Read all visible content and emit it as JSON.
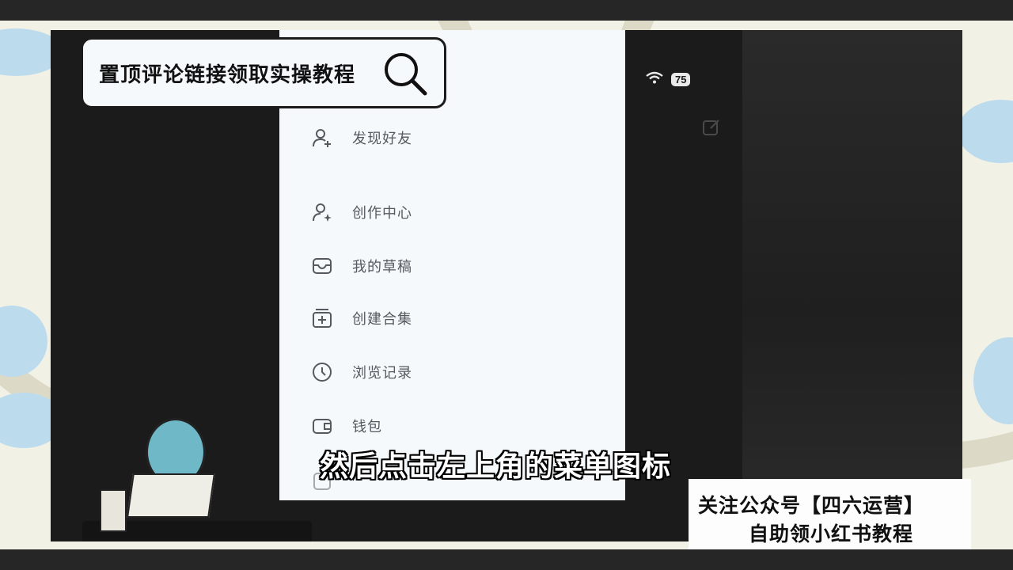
{
  "search": {
    "text": "置顶评论链接领取实操教程"
  },
  "status": {
    "battery": "75"
  },
  "menu": [
    {
      "label": "发现好友",
      "icon": "add-user-icon"
    },
    {
      "label": "创作中心",
      "icon": "creator-icon"
    },
    {
      "label": "我的草稿",
      "icon": "drafts-icon"
    },
    {
      "label": "创建合集",
      "icon": "add-collection-icon"
    },
    {
      "label": "浏览记录",
      "icon": "history-icon"
    },
    {
      "label": "钱包",
      "icon": "wallet-icon"
    }
  ],
  "subtitle": "然后点击左上角的菜单图标",
  "promo": {
    "line1": "关注公众号【四六运营】",
    "line2": "自助领小红书教程"
  },
  "colors": {
    "drawer_bg": "#f6f9fc",
    "screen_bg": "#1b1b1b",
    "frame_bg": "#f2f1e6"
  }
}
